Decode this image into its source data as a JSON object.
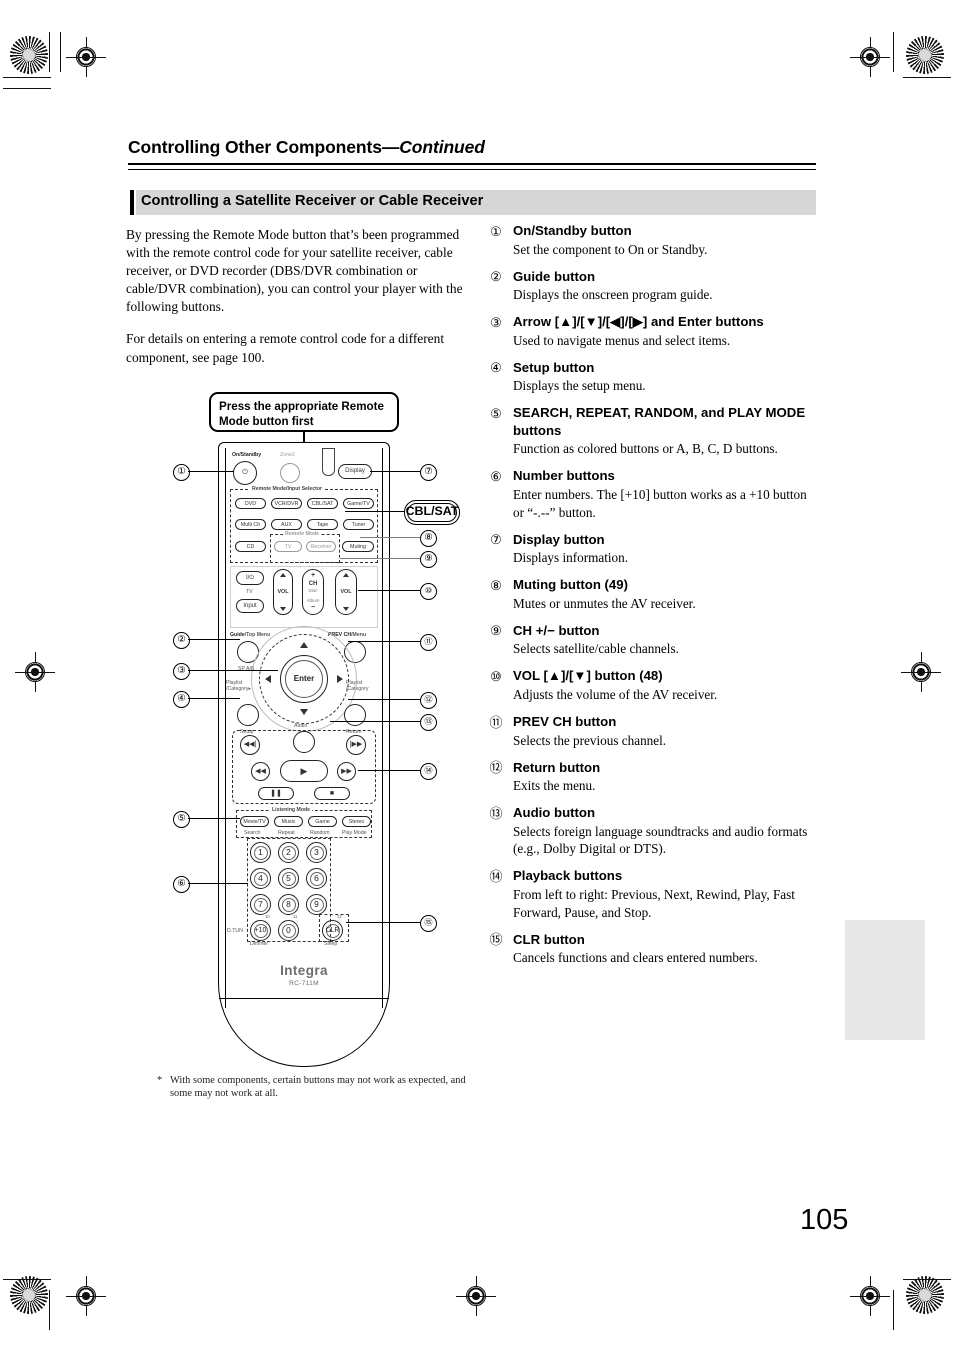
{
  "page": {
    "header_title": "Controlling Other Components",
    "header_suffix": "—Continued",
    "section_title": "Controlling a Satellite Receiver or Cable Receiver",
    "page_number": "105"
  },
  "intro": {
    "p1": "By pressing the Remote Mode button that’s been programmed with the remote control code for your satellite receiver, cable receiver, or DVD recorder (DBS/DVR combination or cable/DVR combination), you can control your player with the following buttons.",
    "p2": "For details on entering a remote control code for a different component, see page 100."
  },
  "callout_bubble": "Press the appropriate Remote Mode button first",
  "mode_badge": "CBL/SAT",
  "footnote": {
    "marker": "*",
    "text": "With some components, certain buttons may not work as expected, and some may not work at all."
  },
  "list": [
    {
      "num": "1",
      "head": "On/Standby button",
      "desc": "Set the component to On or Standby."
    },
    {
      "num": "2",
      "head": "Guide button",
      "desc": "Displays the onscreen program guide."
    },
    {
      "num": "3",
      "head": "Arrow [▲]/[▼]/[◀]/[▶] and Enter buttons",
      "desc": "Used to navigate menus and select items."
    },
    {
      "num": "4",
      "head": "Setup button",
      "desc": "Displays the setup menu."
    },
    {
      "num": "5",
      "head": "SEARCH, REPEAT, RANDOM, and PLAY MODE buttons",
      "desc": "Function as colored buttons or A, B, C, D buttons."
    },
    {
      "num": "6",
      "head": "Number buttons",
      "desc": "Enter numbers. The [+10] button works as a +10 button or “-.--” button."
    },
    {
      "num": "7",
      "head": "Display button",
      "desc": "Displays information."
    },
    {
      "num": "8",
      "head": "Muting button (49)",
      "desc": "Mutes or unmutes the AV receiver."
    },
    {
      "num": "9",
      "head": "CH +/− button",
      "desc": "Selects satellite/cable channels."
    },
    {
      "num": "10",
      "head": "VOL [▲]/[▼] button (48)",
      "desc": "Adjusts the volume of the AV receiver."
    },
    {
      "num": "11",
      "head": "PREV CH button",
      "desc": "Selects the previous channel."
    },
    {
      "num": "12",
      "head": "Return button",
      "desc": "Exits the menu."
    },
    {
      "num": "13",
      "head": "Audio button",
      "desc": "Selects foreign language soundtracks and audio formats (e.g., Dolby Digital or DTS)."
    },
    {
      "num": "14",
      "head": "Playback buttons",
      "desc": "From left to right: Previous, Next, Rewind, Play, Fast Forward, Pause, and Stop."
    },
    {
      "num": "15",
      "head": "CLR button",
      "desc": "Cancels functions and clears entered numbers."
    }
  ],
  "remote": {
    "brand": "Integra",
    "model": "RC-711M",
    "top": {
      "on_standby_label": "On/Standby",
      "on_standby_key": "/",
      "zone2_label": "Zone2",
      "display_key": "Display"
    },
    "input_selector": {
      "group_title": "Remote Mode/Input Selector",
      "keys": [
        "DVD",
        "VCR/DVR",
        "CBL/SAT",
        "Game/TV",
        "Multi Ch",
        "AUX",
        "Tape",
        "Tuner",
        "CD"
      ]
    },
    "remote_mode": {
      "group_title": "Remote Mode",
      "keys": [
        "TV",
        "Receiver"
      ],
      "muting_key": "Muting"
    },
    "tv_zone": {
      "power_key": "/",
      "tv_label": "TV",
      "input_key": "Input",
      "vol_label": "VOL",
      "ch_label": "CH",
      "disc_label": "Disc",
      "album_label": "Album",
      "plus": "+",
      "minus": "−",
      "vol_right_label": "VOL"
    },
    "nav": {
      "guide_label": "Guide",
      "guide_sub": "/Top Menu",
      "sp_ab_label": "SP A/B",
      "prevch_label": "PREV CH",
      "prevch_sub": "/Menu",
      "playlist_left": "Playlist /Category▸",
      "playlist_right": "Playlist /Category",
      "enter_label": "Enter",
      "setup_label": "Setup",
      "return_label": "Return",
      "audio_label": "Audio"
    },
    "listening_mode": {
      "group_title": "Listening Mode",
      "keys": [
        "Movie/TV",
        "Music",
        "Game",
        "Stereo"
      ],
      "sublabels": [
        "Search",
        "Repeat",
        "Random",
        "Play Mode"
      ]
    },
    "numpad": {
      "keys": [
        "1",
        "2",
        "3",
        "4",
        "5",
        "6",
        "7",
        "8",
        "9",
        "+10",
        "0",
        "CLR"
      ],
      "tiny_labels": [
        "10",
        "11",
        "12"
      ],
      "dtun_label": "D.TUN",
      "dimmer_label": "Dimmer",
      "sleep_label": "Sleep"
    }
  }
}
